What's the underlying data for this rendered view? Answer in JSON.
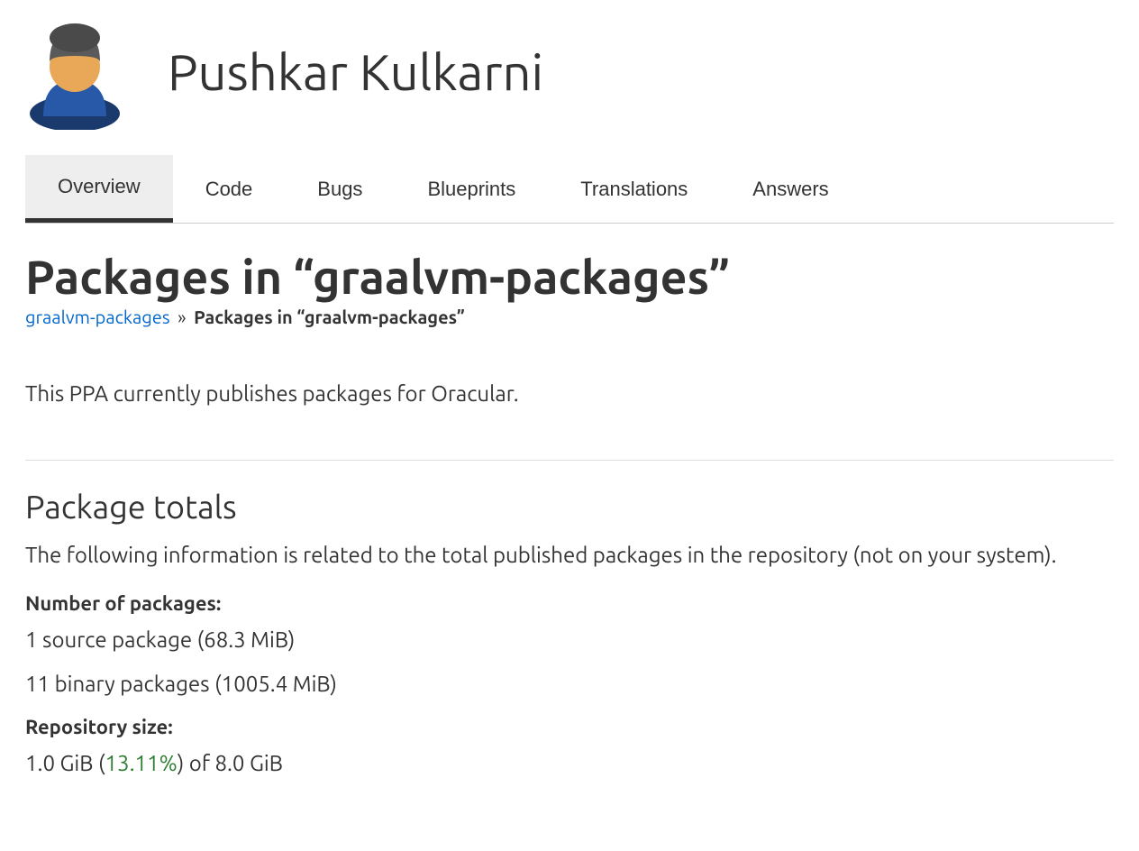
{
  "header": {
    "person_name": "Pushkar Kulkarni"
  },
  "tabs": {
    "items": [
      {
        "label": "Overview",
        "active": true
      },
      {
        "label": "Code",
        "active": false
      },
      {
        "label": "Bugs",
        "active": false
      },
      {
        "label": "Blueprints",
        "active": false
      },
      {
        "label": "Translations",
        "active": false
      },
      {
        "label": "Answers",
        "active": false
      }
    ]
  },
  "page": {
    "title": "Packages in “graalvm-packages”"
  },
  "breadcrumb": {
    "parent": "graalvm-packages",
    "separator": "»",
    "current": "Packages in “graalvm-packages”"
  },
  "description": "This PPA currently publishes packages for Oracular.",
  "totals": {
    "title": "Package totals",
    "description": "The following information is related to the total published packages in the repository (not on your system).",
    "num_packages_label": "Number of packages:",
    "source_packages": "1 source package (68.3 MiB)",
    "binary_packages": "11 binary packages (1005.4 MiB)",
    "repo_size_label": "Repository size:",
    "repo_size_prefix": "1.0 GiB (",
    "repo_size_percent": "13.11%",
    "repo_size_suffix": ") of 8.0 GiB"
  }
}
